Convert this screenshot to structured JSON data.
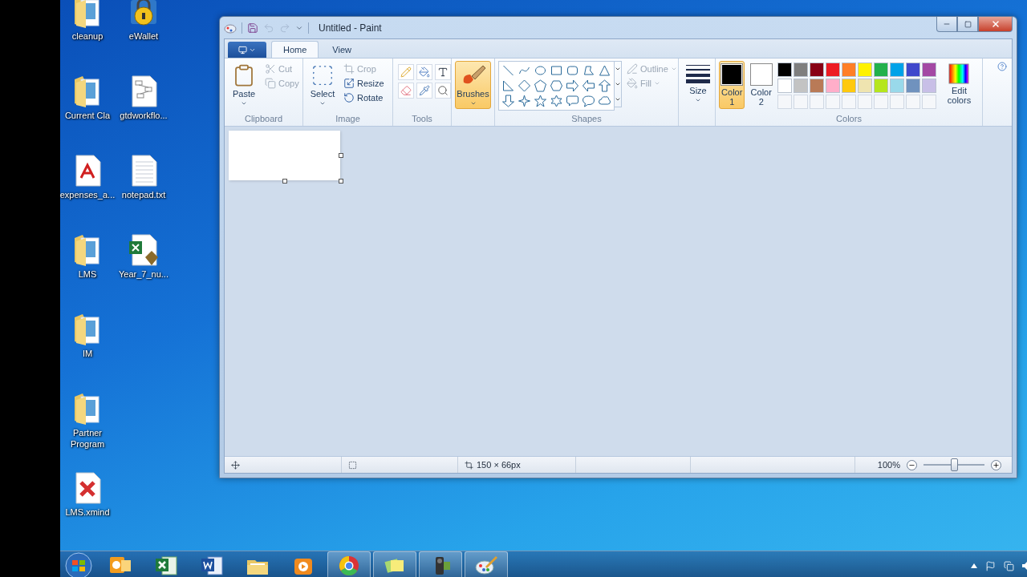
{
  "desktop_icons": [
    {
      "label": "cleanup",
      "kind": "folder"
    },
    {
      "label": "Current Cla",
      "kind": "folder"
    },
    {
      "label": "expenses_a...",
      "kind": "pdf"
    },
    {
      "label": "LMS",
      "kind": "folder"
    },
    {
      "label": "IM",
      "kind": "folder"
    },
    {
      "label": "Partner Program",
      "kind": "folder"
    },
    {
      "label": "LMS.xmind",
      "kind": "xmind"
    },
    {
      "label": "eWallet",
      "kind": "lock"
    },
    {
      "label": "gtdworkflo...",
      "kind": "image"
    },
    {
      "label": "notepad.txt",
      "kind": "text"
    },
    {
      "label": "Year_7_nu...",
      "kind": "excel"
    }
  ],
  "window": {
    "title": "Untitled - Paint"
  },
  "tabs": [
    {
      "label": "Home",
      "selected": true
    },
    {
      "label": "View",
      "selected": false
    }
  ],
  "groups": [
    {
      "kind": "clipboard",
      "label": "Clipboard",
      "large": {
        "label": "Paste"
      },
      "items": [
        {
          "label": "Cut",
          "disabled": true
        },
        {
          "label": "Copy",
          "disabled": true
        }
      ]
    },
    {
      "kind": "image",
      "label": "Image",
      "large": {
        "label": "Select"
      },
      "items": [
        {
          "label": "Crop",
          "disabled": true
        },
        {
          "label": "Resize",
          "disabled": false
        },
        {
          "label": "Rotate",
          "disabled": false
        }
      ]
    },
    {
      "kind": "tools",
      "label": "Tools"
    },
    {
      "kind": "brushes",
      "large": {
        "label": "Brushes",
        "selected": true
      }
    },
    {
      "kind": "shapes",
      "label": "Shapes",
      "items": [
        {
          "label": "Outline",
          "disabled": true
        },
        {
          "label": "Fill",
          "disabled": true
        }
      ]
    },
    {
      "kind": "size",
      "large": {
        "label": "Size"
      }
    },
    {
      "kind": "colors",
      "label": "Colors",
      "slots": [
        {
          "label": "Color 1",
          "color": "#000000",
          "selected": true
        },
        {
          "label": "Color 2",
          "color": "#ffffff",
          "selected": false
        }
      ],
      "palette": [
        {
          "color": "#000000"
        },
        {
          "color": "#7f7f7f"
        },
        {
          "color": "#880015"
        },
        {
          "color": "#ed1c24"
        },
        {
          "color": "#ff7f27"
        },
        {
          "color": "#fff200"
        },
        {
          "color": "#22b14c"
        },
        {
          "color": "#00a2e8"
        },
        {
          "color": "#3f48cc"
        },
        {
          "color": "#a349a4"
        },
        {
          "color": "#ffffff"
        },
        {
          "color": "#c3c3c3"
        },
        {
          "color": "#b97a57"
        },
        {
          "color": "#ffaec9"
        },
        {
          "color": "#ffc90e"
        },
        {
          "color": "#efe4b0"
        },
        {
          "color": "#b5e61d"
        },
        {
          "color": "#99d9ea"
        },
        {
          "color": "#7092be"
        },
        {
          "color": "#c8bfe7"
        }
      ],
      "edit": {
        "label": "Edit colors"
      }
    }
  ],
  "status_bar": {
    "size": "150 × 66px",
    "zoom": "100%",
    "zoom_level": {
      "level": 0.5
    }
  },
  "taskbar": [
    {
      "kind": "outlook",
      "running": false
    },
    {
      "kind": "excel",
      "running": false
    },
    {
      "kind": "word",
      "running": false
    },
    {
      "kind": "explorer",
      "running": false
    },
    {
      "kind": "media",
      "running": false
    },
    {
      "kind": "chrome",
      "running": true
    },
    {
      "kind": "notes",
      "running": true
    },
    {
      "kind": "camera",
      "running": true
    },
    {
      "kind": "paint",
      "running": true
    }
  ]
}
